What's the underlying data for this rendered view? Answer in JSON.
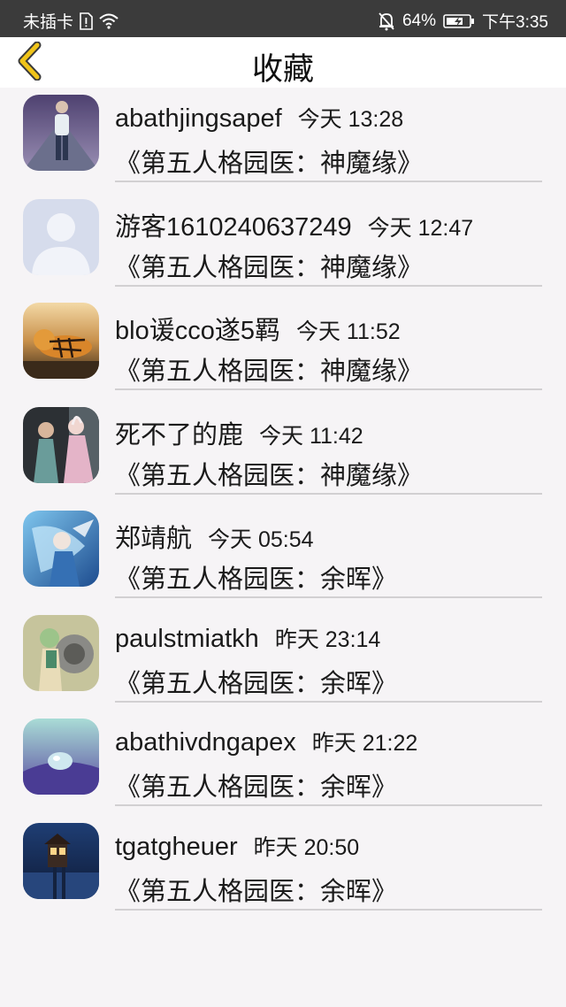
{
  "status_bar": {
    "carrier": "未插卡",
    "battery_percent": "64%",
    "time": "下午3:35",
    "icons": [
      "sim-alert-icon",
      "wifi-icon",
      "bell-off-icon",
      "battery-charging-icon"
    ]
  },
  "header": {
    "title": "收藏",
    "back_icon": "chevron-left-icon",
    "accent_color": "#f0c419"
  },
  "favorites": [
    {
      "name": "abathjingsapef",
      "time": "今天 13:28",
      "book": "《第五人格园医：神魔缘》",
      "avatar": "person-walking-photo"
    },
    {
      "name": "游客1610240637249",
      "time": "今天 12:47",
      "book": "《第五人格园医：神魔缘》",
      "avatar": "default-person-silhouette"
    },
    {
      "name": "blo谖cco遂5羁",
      "time": "今天 11:52",
      "book": "《第五人格园医：神魔缘》",
      "avatar": "tiger-photo"
    },
    {
      "name": "死不了的鹿",
      "time": "今天 11:42",
      "book": "《第五人格园医：神魔缘》",
      "avatar": "anime-characters-image"
    },
    {
      "name": "郑靖航",
      "time": "今天 05:54",
      "book": "《第五人格园医：余晖》",
      "avatar": "blue-anime-character-image"
    },
    {
      "name": "paulstmiatkh",
      "time": "昨天 23:14",
      "book": "《第五人格园医：余晖》",
      "avatar": "anime-mecha-image"
    },
    {
      "name": "abathivdngapex",
      "time": "昨天 21:22",
      "book": "《第五人格园医：余晖》",
      "avatar": "water-droplet-photo"
    },
    {
      "name": "tgatgheuer",
      "time": "昨天 20:50",
      "book": "《第五人格园医：余晖》",
      "avatar": "lit-house-at-night-photo"
    }
  ]
}
